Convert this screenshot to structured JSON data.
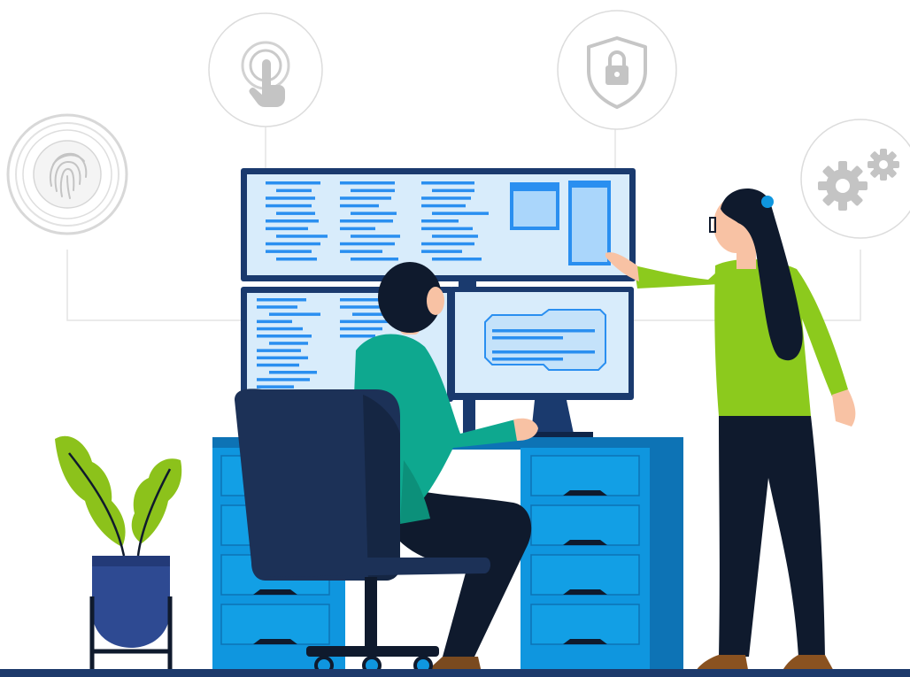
{
  "illustration": {
    "caption": "",
    "security_icons": [
      {
        "icon": "fingerprint-icon"
      },
      {
        "icon": "tap-hand-icon"
      },
      {
        "icon": "shield-lock-icon"
      },
      {
        "icon": "gears-icon"
      }
    ],
    "people": [
      {
        "role": "man-seated-at-desk"
      },
      {
        "role": "woman-pointing-at-screen"
      }
    ],
    "monitors": [
      "top-wide-code-monitor",
      "left-code-monitor",
      "right-chip-monitor"
    ],
    "colors": {
      "background": "#ffffff",
      "icon_ring": "#dcdcdc",
      "icon_glyph": "#c4c4c4",
      "monitor_frame": "#1a3a6e",
      "screen": "#d8ecfb",
      "code_line": "#2a8ff0",
      "desk_blue": "#0f96df",
      "desk_dark": "#0d73b5",
      "chair_navy": "#1c3157",
      "man_shirt": "#0ea88f",
      "woman_shirt": "#8cca1d",
      "hair_dark": "#0f1a2d",
      "skin": "#f8c2a4",
      "plant_green": "#8cc21b",
      "pot_blue": "#2e4a92",
      "floor": "#1d3a6b"
    }
  }
}
